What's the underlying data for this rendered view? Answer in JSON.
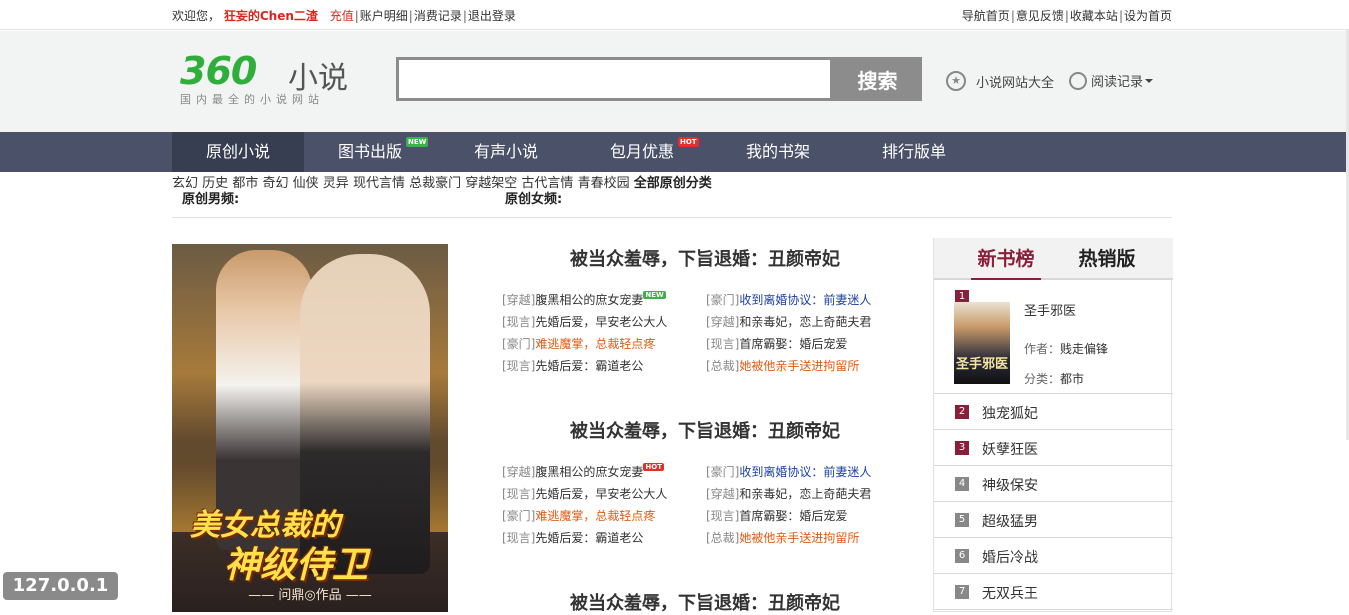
{
  "topbar": {
    "welcome": "欢迎您，",
    "username": "狂妄的Chen二渣",
    "recharge": "充值",
    "account": "账户明细",
    "consume": "消费记录",
    "logout": "退出登录",
    "nav_home": "导航首页",
    "feedback": "意见反馈",
    "bookmark": "收藏本站",
    "set_home": "设为首页"
  },
  "header": {
    "logo_num": "360",
    "logo_word": "小说",
    "logo_slogan": "国内最全的小说网站",
    "search_placeholder": "",
    "search_button": "搜索",
    "sites_link": "小说网站大全",
    "history_link": "阅读记录"
  },
  "nav": {
    "items": [
      {
        "label": "原创小说",
        "active": true
      },
      {
        "label": "图书出版",
        "badge": "NEW"
      },
      {
        "label": "有声小说"
      },
      {
        "label": "包月优惠",
        "badge": "HOT"
      },
      {
        "label": "我的书架"
      },
      {
        "label": "排行版单"
      }
    ]
  },
  "categories": {
    "male_label": "原创男频:",
    "male": [
      "玄幻",
      "历史",
      "都市",
      "奇幻",
      "仙侠",
      "灵异"
    ],
    "female_label": "原创女频:",
    "female": [
      "现代言情",
      "总裁豪门",
      "穿越架空",
      "古代言情",
      "青春校园"
    ],
    "all": "全部原创分类"
  },
  "cover": {
    "title_line1": "美女总裁的",
    "title_line2": "神级侍卫",
    "author": "—— 问鼎◎作品 ——"
  },
  "blocks": [
    {
      "title": "被当众羞辱，下旨退婚：丑颜帝妃",
      "left": [
        {
          "tag": "[穿越]",
          "text": "腹黑相公的庶女宠妻",
          "badge": "NEW",
          "color": "dark"
        },
        {
          "tag": "[现言]",
          "text": "先婚后爱，早安老公大人",
          "color": "dark"
        },
        {
          "tag": "[豪门]",
          "text": "难逃魔掌，总裁轻点疼",
          "color": "orange"
        },
        {
          "tag": "[现言]",
          "text": "先婚后爱：霸道老公",
          "color": "dark"
        }
      ],
      "right": [
        {
          "tag": "[豪门]",
          "text": "收到离婚协议：前妻迷人",
          "color": "blue"
        },
        {
          "tag": "[穿越]",
          "text": "和亲毒妃，恋上奇葩夫君",
          "color": "dark"
        },
        {
          "tag": "[现言]",
          "text": "首席霸娶：婚后宠爱",
          "color": "dark"
        },
        {
          "tag": "[总裁]",
          "text": "她被他亲手送进拘留所",
          "color": "orange"
        }
      ]
    },
    {
      "title": "被当众羞辱，下旨退婚：丑颜帝妃",
      "left": [
        {
          "tag": "[穿越]",
          "text": "腹黑相公的庶女宠妻",
          "badge": "HOT",
          "color": "dark"
        },
        {
          "tag": "[现言]",
          "text": "先婚后爱，早安老公大人",
          "color": "dark"
        },
        {
          "tag": "[豪门]",
          "text": "难逃魔掌，总裁轻点疼",
          "color": "orange"
        },
        {
          "tag": "[现言]",
          "text": "先婚后爱：霸道老公",
          "color": "dark"
        }
      ],
      "right": [
        {
          "tag": "[豪门]",
          "text": "收到离婚协议：前妻迷人",
          "color": "blue"
        },
        {
          "tag": "[穿越]",
          "text": "和亲毒妃，恋上奇葩夫君",
          "color": "dark"
        },
        {
          "tag": "[现言]",
          "text": "首席霸娶：婚后宠爱",
          "color": "dark"
        },
        {
          "tag": "[总裁]",
          "text": "她被他亲手送进拘留所",
          "color": "orange"
        }
      ]
    },
    {
      "title": "被当众羞辱，下旨退婚：丑颜帝妃"
    }
  ],
  "ranking": {
    "tab_new": "新书榜",
    "tab_hot": "热销版",
    "first": {
      "num": "1",
      "name": "圣手邪医",
      "author_label": "作者：",
      "author": "贱走偏锋",
      "cat_label": "分类：",
      "category": "都市",
      "thumb_text": "圣手邪医"
    },
    "items": [
      {
        "num": "2",
        "name": "独宠狐妃"
      },
      {
        "num": "3",
        "name": "妖孽狂医"
      },
      {
        "num": "4",
        "name": "神级保安"
      },
      {
        "num": "5",
        "name": "超级猛男"
      },
      {
        "num": "6",
        "name": "婚后冷战"
      },
      {
        "num": "7",
        "name": "无双兵王"
      }
    ]
  },
  "overlay": {
    "ip": "127.0.0.1"
  }
}
